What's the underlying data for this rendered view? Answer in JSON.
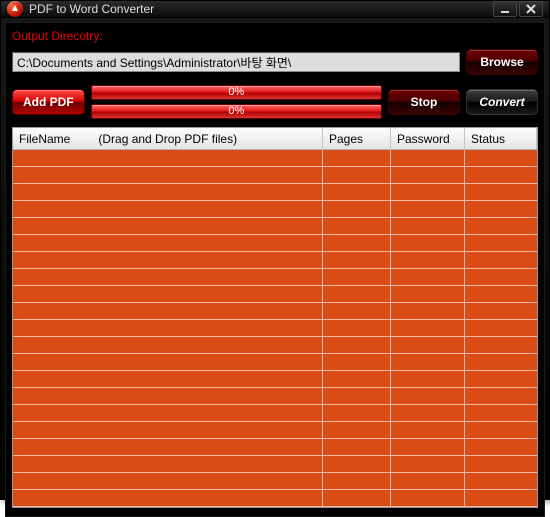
{
  "window": {
    "title": "PDF to Word Converter"
  },
  "output": {
    "label": "Output Direcotry:",
    "path": "C:\\Documents and Settings\\Administrator\\바탕 화면\\"
  },
  "buttons": {
    "browse": "Browse",
    "add_pdf": "Add PDF",
    "stop": "Stop",
    "convert": "Convert"
  },
  "progress": {
    "p1": "0%",
    "p2": "0%"
  },
  "table": {
    "headers": {
      "filename": "FileName",
      "hint": "(Drag and Drop PDF files)",
      "pages": "Pages",
      "password": "Password",
      "status": "Status"
    },
    "rows": []
  },
  "render": {
    "empty_row_count": 21
  },
  "colors": {
    "accent": "#d40000",
    "grid": "#da4c15"
  }
}
